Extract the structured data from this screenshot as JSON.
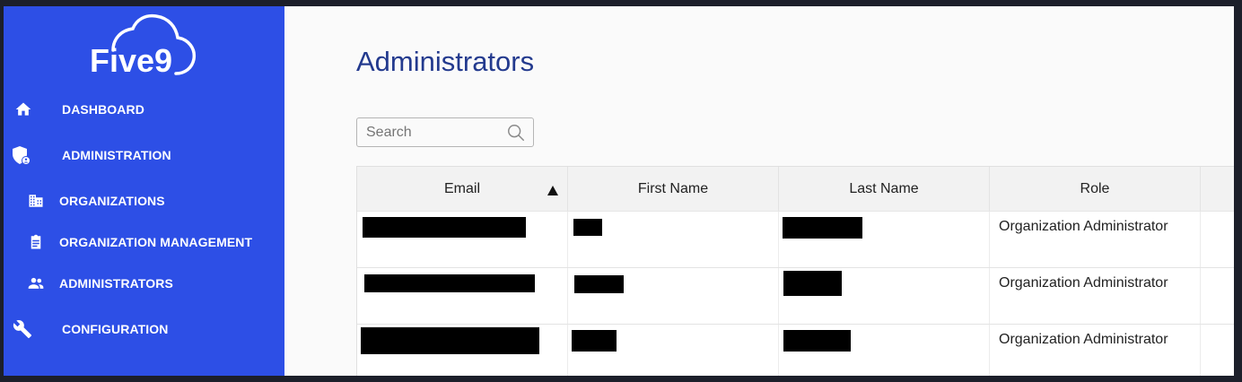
{
  "brand": {
    "logo_text": "Five9",
    "accent": "#2d4fe6",
    "title_color": "#233a8e"
  },
  "sidebar": {
    "items": [
      {
        "label": "DASHBOARD",
        "icon": "home-icon"
      },
      {
        "label": "ADMINISTRATION",
        "icon": "shield-user-icon"
      },
      {
        "label": "ORGANIZATIONS",
        "icon": "building-icon"
      },
      {
        "label": "ORGANIZATION MANAGEMENT",
        "icon": "clipboard-icon"
      },
      {
        "label": "ADMINISTRATORS",
        "icon": "people-icon"
      },
      {
        "label": "CONFIGURATION",
        "icon": "wrench-icon"
      }
    ]
  },
  "main": {
    "title": "Administrators",
    "search": {
      "placeholder": "Search",
      "value": "",
      "icon": "search-icon"
    },
    "table": {
      "columns": [
        "Email",
        "First Name",
        "Last Name",
        "Role"
      ],
      "sort": {
        "column": "Email",
        "direction": "ascending"
      },
      "rows": [
        {
          "role": "Organization Administrator"
        },
        {
          "role": "Organization Administrator"
        },
        {
          "role": "Organization Administrator"
        }
      ]
    }
  }
}
